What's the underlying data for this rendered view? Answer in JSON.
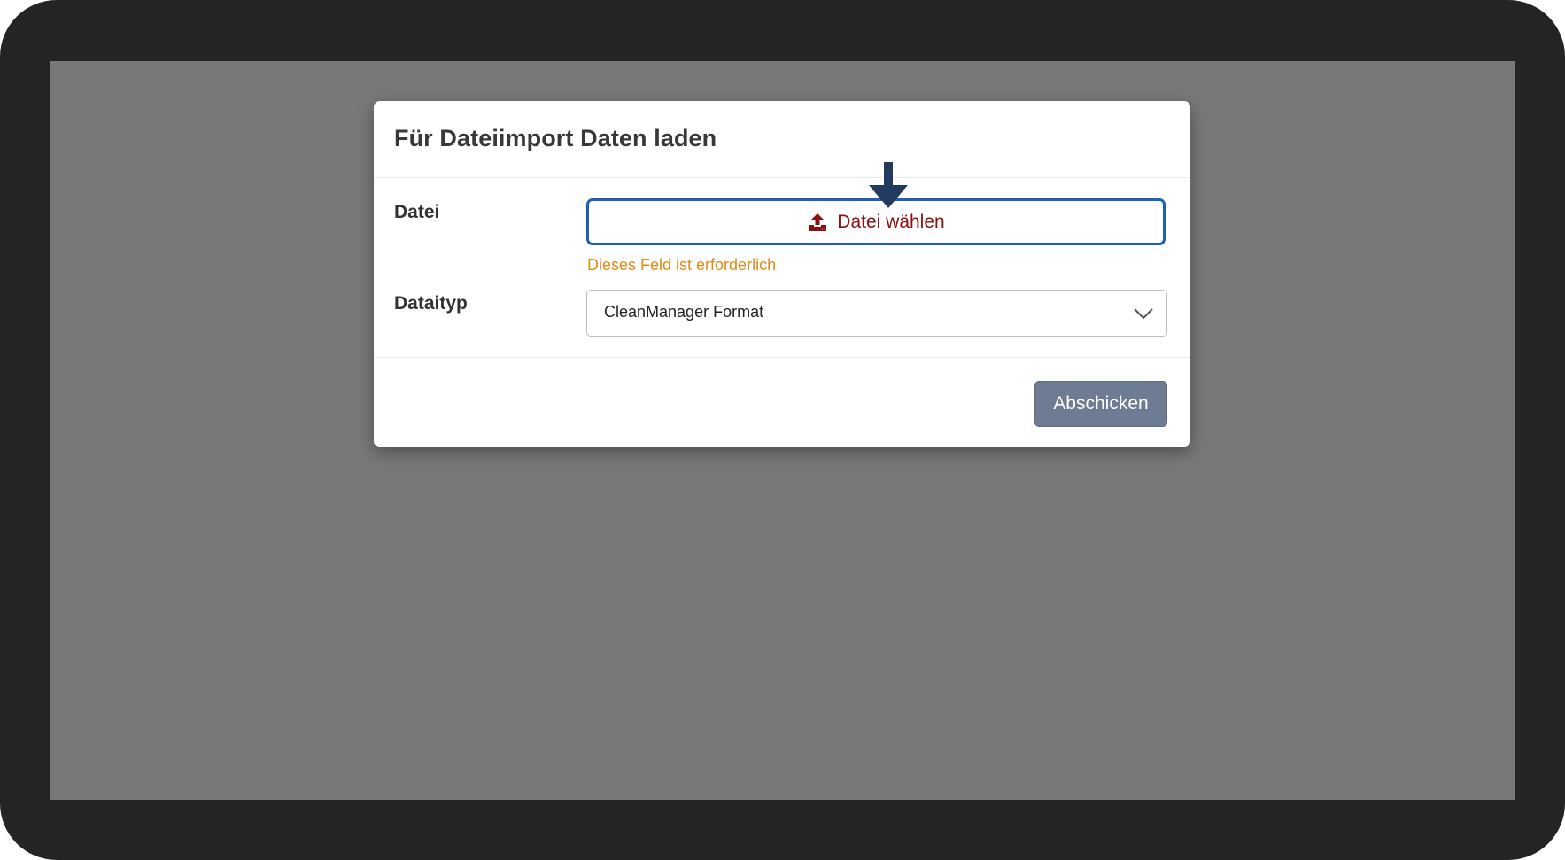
{
  "dialog": {
    "title": "Für Dateiimport Daten laden"
  },
  "file_field": {
    "label": "Datei",
    "button_label": "Datei wählen",
    "icon": "upload-icon",
    "error": "Dieses Feld ist erforderlich"
  },
  "type_field": {
    "label": "Dataityp",
    "selected": "CleanManager Format",
    "icon": "chevron-down-icon"
  },
  "footer": {
    "submit_label": "Abschicken"
  },
  "annotation": {
    "icon": "pointer-arrow-icon"
  },
  "colors": {
    "frame": "#242424",
    "overlay": "#787878",
    "focus_border": "#1f5fb8",
    "button_text": "#8c1010",
    "error": "#e28a16",
    "submit_bg": "#6d7c92",
    "arrow": "#223a5e"
  }
}
